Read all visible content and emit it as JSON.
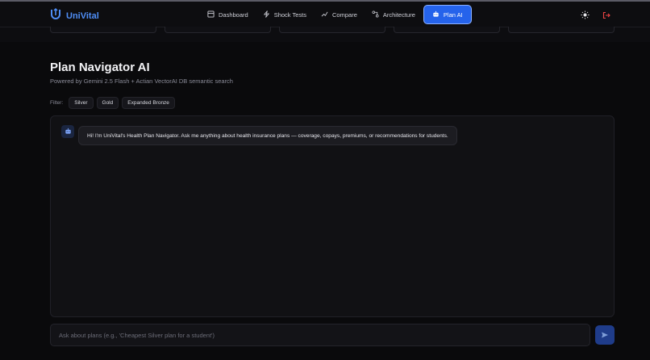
{
  "brand": {
    "name": "UniVital",
    "accent": "#4f8ef7"
  },
  "nav": {
    "items": [
      {
        "label": "Dashboard",
        "icon": "dashboard-icon"
      },
      {
        "label": "Shock Tests",
        "icon": "bolt-icon"
      },
      {
        "label": "Compare",
        "icon": "compare-icon"
      },
      {
        "label": "Architecture",
        "icon": "architecture-icon"
      },
      {
        "label": "Plan AI",
        "icon": "bot-icon",
        "active": true
      }
    ],
    "theme_icon": "sun-icon",
    "logout_icon": "logout-icon"
  },
  "page": {
    "title": "Plan Navigator AI",
    "subtitle": "Powered by Gemini 2.5 Flash + Actian VectorAI DB semantic search"
  },
  "filters": {
    "label": "Filter:",
    "options": [
      "Silver",
      "Gold",
      "Expanded Bronze"
    ]
  },
  "chat": {
    "messages": [
      {
        "role": "assistant",
        "text": "Hi! I'm UniVital's Health Plan Navigator. Ask me anything about health insurance plans — coverage, copays, premiums, or recommendations for students."
      }
    ],
    "input_value": "",
    "input_placeholder": "Ask about plans (e.g., 'Cheapest Silver plan for a student')",
    "send_icon": "send-icon"
  },
  "colors": {
    "active_nav": "#2563eb",
    "background": "#0a0a0c",
    "logout": "#ef4444"
  }
}
